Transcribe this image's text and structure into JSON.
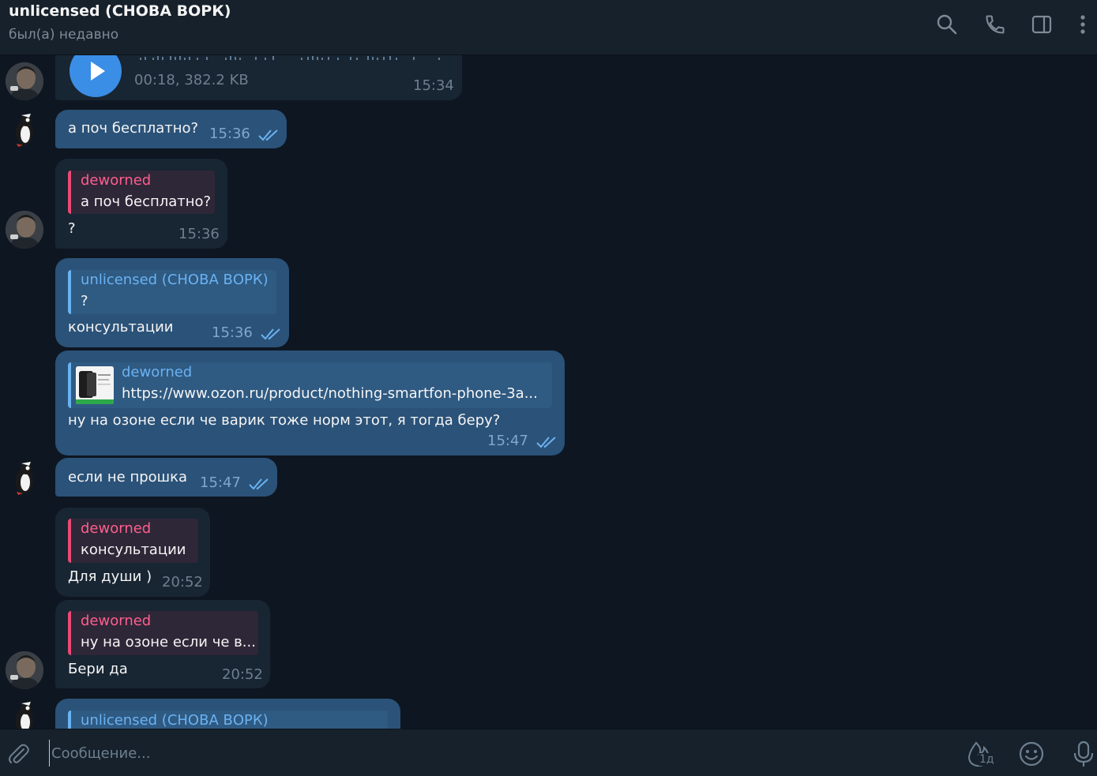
{
  "header": {
    "title": "unlicensed (СНОВА ВОРК)",
    "status": "был(а) недавно"
  },
  "messages": {
    "voice": {
      "meta": "00:18, 382.2 KB",
      "time": "15:34"
    },
    "m1": {
      "text": "а поч бесплатно?",
      "time": "15:36"
    },
    "m2": {
      "reply_name": "deworned",
      "reply_text": "а поч бесплатно?",
      "text": "?",
      "time": "15:36"
    },
    "m3": {
      "reply_name": "unlicensed (СНОВА ВОРК)",
      "reply_text": "?",
      "text": "консультации",
      "time": "15:36"
    },
    "m4": {
      "reply_name": "deworned",
      "reply_text": "https://www.ozon.ru/product/nothing-smartfon-phone-3a...",
      "text": "ну на озоне если че варик тоже норм этот, я тогда беру?",
      "time": "15:47"
    },
    "m5": {
      "text": "если не прошка",
      "time": "15:47"
    },
    "m6": {
      "reply_name": "deworned",
      "reply_text": "консультации",
      "text": "Для души )",
      "time": "20:52"
    },
    "m7": {
      "reply_name": "deworned",
      "reply_text": "ну на озоне если че в...",
      "text": "Бери да",
      "time": "20:52"
    },
    "m8": {
      "reply_name": "unlicensed (СНОВА ВОРК)"
    }
  },
  "input": {
    "placeholder": "Сообщение...",
    "timer_badge": "1д"
  },
  "colors": {
    "background": "#0e1621",
    "header": "#17212b",
    "bubble_out": "#2b5278",
    "bubble_in": "#182533",
    "accent": "#6ab2f2",
    "reply_pink": "#ff5e8d"
  },
  "icons": [
    "search-icon",
    "phone-icon",
    "sidebar-toggle-icon",
    "more-vertical-icon",
    "paperclip-icon",
    "timer-fire-icon",
    "emoji-icon",
    "microphone-icon",
    "play-icon",
    "double-check-icon"
  ]
}
